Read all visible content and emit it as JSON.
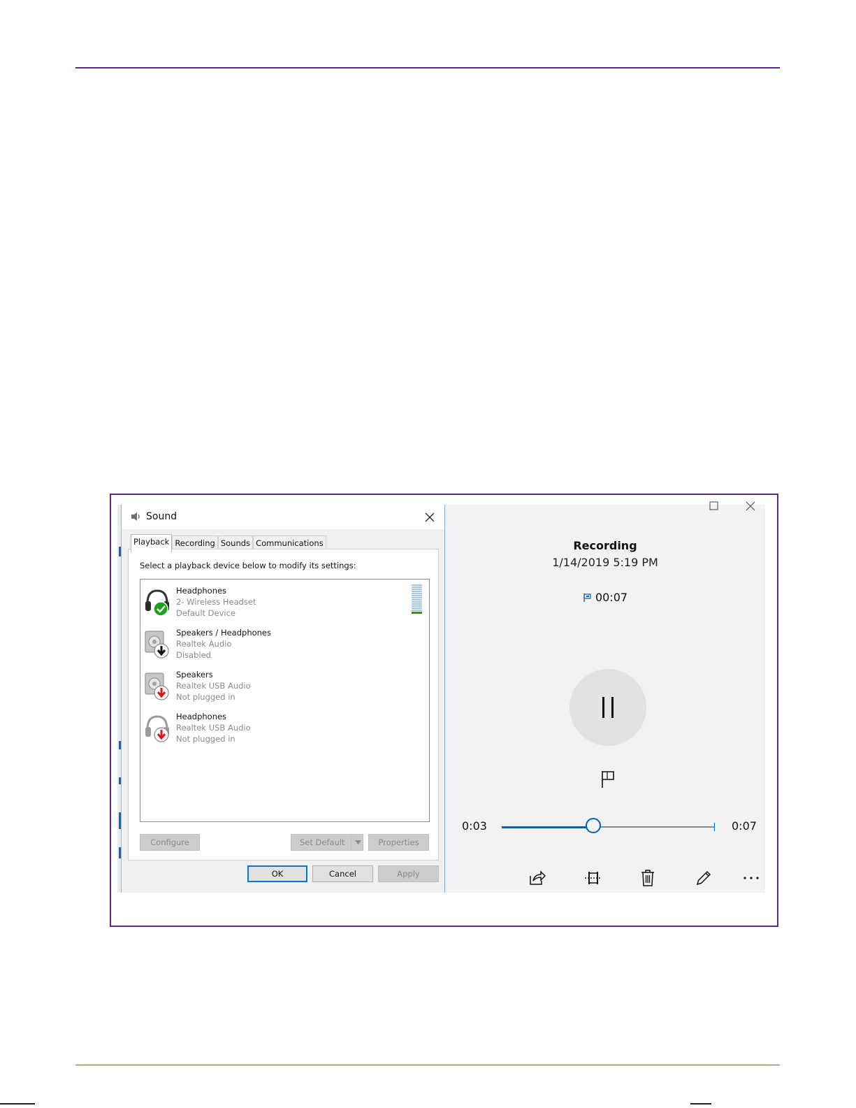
{
  "sound_dialog": {
    "title": "Sound",
    "tabs": [
      {
        "label": "Playback",
        "active": true
      },
      {
        "label": "Recording",
        "active": false
      },
      {
        "label": "Sounds",
        "active": false
      },
      {
        "label": "Communications",
        "active": false
      }
    ],
    "instruction": "Select a playback device below to modify its settings:",
    "devices": [
      {
        "name": "Headphones",
        "line2": "2- Wireless Headset",
        "line3": "Default Device",
        "icon": "headphones-icon",
        "status_icon": "default-check-icon"
      },
      {
        "name": "Speakers / Headphones",
        "line2": "Realtek Audio",
        "line3": "Disabled",
        "icon": "speaker-icon",
        "status_icon": "disabled-down-arrow-icon"
      },
      {
        "name": "Speakers",
        "line2": "Realtek USB Audio",
        "line3": "Not plugged in",
        "icon": "speaker-icon",
        "status_icon": "unplugged-red-arrow-icon"
      },
      {
        "name": "Headphones",
        "line2": "Realtek USB Audio",
        "line3": "Not plugged in",
        "icon": "headphones-icon",
        "status_icon": "unplugged-red-arrow-icon"
      }
    ],
    "buttons": {
      "configure": "Configure",
      "set_default": "Set Default",
      "properties": "Properties",
      "ok": "OK",
      "cancel": "Cancel",
      "apply": "Apply"
    }
  },
  "recorder": {
    "title": "Recording",
    "date": "1/14/2019 5:19 PM",
    "marker_time": "00:07",
    "current_time": "0:03",
    "total_time": "0:07",
    "progress_fraction": 0.43
  },
  "colors": {
    "frame": "#5b2a86",
    "accent_blue": "#0063b1",
    "dialog_focus": "#0078d7",
    "level_green": "#1aa31a"
  }
}
